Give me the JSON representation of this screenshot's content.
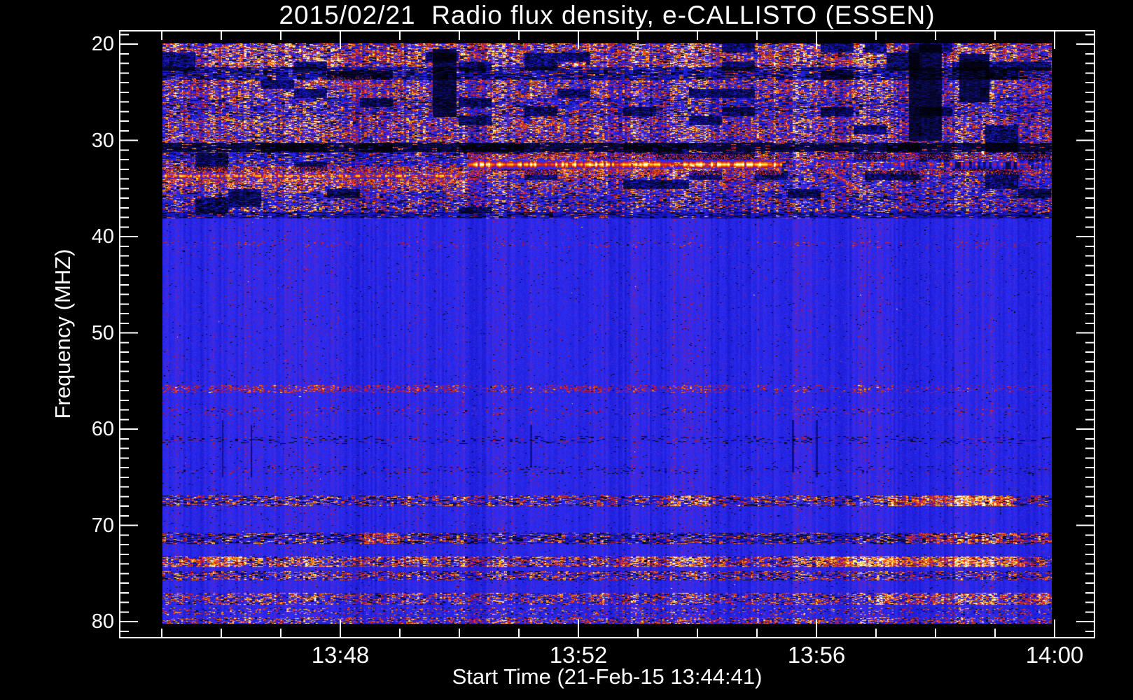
{
  "chart_data": {
    "type": "heatmap",
    "instrument": "spectrogram",
    "title": "2015/02/21  Radio flux density, e-CALLISTO (ESSEN)",
    "xlabel": "Start Time (21-Feb-15 13:44:41)",
    "ylabel": "Frequency (MHZ)",
    "x_axis": {
      "unit": "minutes after 13:44",
      "major_ticks": [
        {
          "label": "13:48",
          "minute": 4
        },
        {
          "label": "13:52",
          "minute": 8
        },
        {
          "label": "13:56",
          "minute": 12
        },
        {
          "label": "14:00",
          "minute": 16
        }
      ],
      "minor_tick_minutes": [
        1,
        2,
        3,
        5,
        6,
        7,
        9,
        10,
        11,
        13,
        14,
        15
      ]
    },
    "y_axis": {
      "unit": "MHz",
      "inverted": true,
      "range_approx": [
        18.6,
        81.7
      ],
      "major_ticks_mhz": [
        20,
        30,
        40,
        50,
        60,
        70,
        80
      ],
      "minor_ticks_mhz": [
        19,
        21,
        22,
        23,
        24,
        25,
        26,
        27,
        28,
        29,
        31,
        32,
        33,
        34,
        35,
        36,
        37,
        38,
        39,
        41,
        42,
        43,
        44,
        45,
        46,
        47,
        48,
        49,
        51,
        52,
        53,
        54,
        55,
        56,
        57,
        58,
        59,
        61,
        62,
        63,
        64,
        65,
        66,
        67,
        68,
        69,
        71,
        72,
        73,
        74,
        75,
        76,
        77,
        78,
        79,
        81
      ]
    },
    "data_extent": {
      "t0_min": 1.01,
      "t1_min": 15.95,
      "f0_mhz": 19.93,
      "f1_mhz": 80.22
    },
    "palette": {
      "stops": [
        [
          0.0,
          "#000000"
        ],
        [
          0.14,
          "#08083c"
        ],
        [
          0.32,
          "#1414c8"
        ],
        [
          0.5,
          "#2e2ef4"
        ],
        [
          0.58,
          "#5a24c8"
        ],
        [
          0.66,
          "#96145a"
        ],
        [
          0.75,
          "#e62814"
        ],
        [
          0.85,
          "#ff8c00"
        ],
        [
          0.93,
          "#fff050"
        ],
        [
          1.0,
          "#ffffff"
        ]
      ]
    },
    "ocean_default": {
      "f0": 0,
      "f1": 0,
      "base": 0.46,
      "amp": 0.1,
      "red": 0.035,
      "spark": 0.002,
      "black": 0.008,
      "dash": 2,
      "redLo": 0.55,
      "redHi": 0.66
    },
    "bands": [
      {
        "f0": 19.9,
        "f1": 22.4,
        "base": 0.45,
        "amp": 0.3,
        "red": 0.5,
        "spark": 0.18,
        "black": 0.18,
        "dash": 5
      },
      {
        "f0": 22.4,
        "f1": 23.7,
        "base": 0.34,
        "amp": 0.22,
        "red": 0.12,
        "spark": 0.02,
        "black": 0.38,
        "dash": 6
      },
      {
        "f0": 23.7,
        "f1": 25.6,
        "base": 0.44,
        "amp": 0.26,
        "red": 0.42,
        "spark": 0.08,
        "black": 0.12,
        "dash": 4
      },
      {
        "f0": 25.6,
        "f1": 27.6,
        "base": 0.42,
        "amp": 0.26,
        "red": 0.28,
        "spark": 0.05,
        "black": 0.22,
        "dash": 5
      },
      {
        "f0": 27.6,
        "f1": 30.2,
        "base": 0.44,
        "amp": 0.26,
        "red": 0.42,
        "spark": 0.1,
        "black": 0.16,
        "dash": 4
      },
      {
        "f0": 30.2,
        "f1": 31.2,
        "base": 0.18,
        "amp": 0.2,
        "red": 0.06,
        "spark": 0.01,
        "black": 0.5,
        "dash": 7
      },
      {
        "f0": 31.2,
        "f1": 32.0,
        "base": 0.4,
        "amp": 0.24,
        "red": 0.2,
        "spark": 0.04,
        "black": 0.26,
        "dash": 5,
        "segs": [
          {
            "t0": 6.1,
            "t1": 16,
            "red": 0.35,
            "spark": 0.06
          }
        ]
      },
      {
        "f0": 32.0,
        "f1": 32.9,
        "base": 0.4,
        "amp": 0.22,
        "red": 0.24,
        "spark": 0.05,
        "black": 0.2,
        "dash": 5
      },
      {
        "f0": 32.9,
        "f1": 33.3,
        "base": 0.4,
        "amp": 0.22,
        "red": 0.3,
        "spark": 0.06,
        "black": 0.2,
        "dash": 4,
        "segs": [
          {
            "t0": 6.1,
            "t1": 11.5,
            "red": 0.5,
            "spark": 0.08
          }
        ]
      },
      {
        "f0": 33.3,
        "f1": 34.0,
        "base": 0.42,
        "amp": 0.22,
        "red": 0.3,
        "spark": 0.06,
        "black": 0.16,
        "dash": 4,
        "segs": [
          {
            "t0": 6.1,
            "t1": 11.5,
            "red": 0.45,
            "spark": 0.06
          }
        ]
      },
      {
        "f0": 34.0,
        "f1": 35.3,
        "base": 0.44,
        "amp": 0.22,
        "red": 0.3,
        "spark": 0.05,
        "black": 0.14,
        "dash": 4,
        "segs": [
          {
            "t0": 1.0,
            "t1": 6.1,
            "red": 0.45,
            "spark": 0.08
          },
          {
            "t0": 6.1,
            "t1": 11.5,
            "red": 0.38,
            "spark": 0.04
          }
        ]
      },
      {
        "f0": 35.3,
        "f1": 36.5,
        "base": 0.42,
        "amp": 0.24,
        "red": 0.26,
        "spark": 0.04,
        "black": 0.2,
        "dash": 5
      },
      {
        "f0": 36.5,
        "f1": 37.4,
        "base": 0.4,
        "amp": 0.24,
        "red": 0.3,
        "spark": 0.05,
        "black": 0.2,
        "dash": 4
      },
      {
        "f0": 37.4,
        "f1": 38.1,
        "base": 0.33,
        "amp": 0.16,
        "red": 0.08,
        "spark": 0.0,
        "black": 0.3,
        "dash": 6
      },
      {
        "f0": 40.5,
        "f1": 41.1,
        "base": 0.46,
        "amp": 0.1,
        "red": 0.1,
        "spark": 0.0,
        "black": 0.01,
        "dash": 3,
        "redLo": 0.58,
        "redHi": 0.72
      },
      {
        "f0": 55.4,
        "f1": 56.2,
        "base": 0.46,
        "amp": 0.1,
        "red": 0.18,
        "spark": 0.01,
        "black": 0.02,
        "dash": 3,
        "redLo": 0.6,
        "redHi": 0.78,
        "segs": [
          {
            "t0": 1.0,
            "t1": 6.0,
            "red": 0.38
          },
          {
            "t0": 7.4,
            "t1": 10.6,
            "red": 0.3
          }
        ]
      },
      {
        "f0": 57.7,
        "f1": 58.5,
        "base": 0.46,
        "amp": 0.1,
        "red": 0.15,
        "spark": 0.0,
        "black": 0.03,
        "dash": 3,
        "redLo": 0.56,
        "redHi": 0.7
      },
      {
        "f0": 60.7,
        "f1": 61.5,
        "base": 0.45,
        "amp": 0.1,
        "red": 0.08,
        "spark": 0.0,
        "black": 0.1,
        "dash": 4,
        "redLo": 0.56,
        "redHi": 0.7
      },
      {
        "f0": 63.8,
        "f1": 64.6,
        "base": 0.45,
        "amp": 0.1,
        "red": 0.08,
        "spark": 0.0,
        "black": 0.05,
        "dash": 3,
        "redLo": 0.56,
        "redHi": 0.7
      },
      {
        "f0": 66.9,
        "f1": 68.0,
        "base": 0.42,
        "amp": 0.18,
        "red": 0.3,
        "spark": 0.03,
        "black": 0.22,
        "dash": 5,
        "segs": [
          {
            "t0": 9.5,
            "t1": 10.3,
            "red": 0.55,
            "spark": 0.12
          },
          {
            "t0": 13.2,
            "t1": 15.3,
            "red": 0.7,
            "spark": 0.3
          },
          {
            "t0": 14.15,
            "t1": 14.85,
            "red": 0.85,
            "spark": 0.5
          }
        ]
      },
      {
        "f0": 70.7,
        "f1": 71.9,
        "base": 0.4,
        "amp": 0.18,
        "red": 0.2,
        "spark": 0.03,
        "black": 0.3,
        "dash": 5,
        "segs": [
          {
            "t0": 4.4,
            "t1": 5.0,
            "red": 0.6,
            "spark": 0.1
          },
          {
            "t0": 13.5,
            "t1": 16.0,
            "red": 0.5,
            "spark": 0.1
          }
        ]
      },
      {
        "f0": 73.2,
        "f1": 74.3,
        "base": 0.42,
        "amp": 0.2,
        "red": 0.5,
        "spark": 0.1,
        "black": 0.2,
        "dash": 4,
        "segs": [
          {
            "t0": 1.6,
            "t1": 2.35,
            "red": 0.8,
            "spark": 0.2
          },
          {
            "t0": 8.7,
            "t1": 10.5,
            "red": 0.7,
            "spark": 0.15
          },
          {
            "t0": 12.0,
            "t1": 15.5,
            "red": 0.85,
            "spark": 0.35
          }
        ]
      },
      {
        "f0": 74.7,
        "f1": 75.7,
        "base": 0.42,
        "amp": 0.18,
        "red": 0.32,
        "spark": 0.03,
        "black": 0.2,
        "dash": 4
      },
      {
        "f0": 77.0,
        "f1": 78.2,
        "base": 0.43,
        "amp": 0.18,
        "red": 0.35,
        "spark": 0.04,
        "black": 0.12,
        "dash": 4,
        "segs": [
          {
            "t0": 13.0,
            "t1": 16.0,
            "red": 0.6,
            "spark": 0.25
          }
        ]
      },
      {
        "f0": 78.5,
        "f1": 79.3,
        "base": 0.45,
        "amp": 0.14,
        "red": 0.15,
        "spark": 0.01,
        "black": 0.05,
        "dash": 3
      },
      {
        "f0": 79.5,
        "f1": 80.3,
        "base": 0.44,
        "amp": 0.16,
        "red": 0.35,
        "spark": 0.03,
        "black": 0.1,
        "dash": 3
      }
    ],
    "bright_lines": [
      {
        "t0": 1.0,
        "t1": 6.08,
        "f0": 33.32,
        "f1": 34.0,
        "peak": 0.95,
        "flick": 0.4,
        "fringe": 0.4
      },
      {
        "t0": 6.12,
        "t1": 11.42,
        "f0": 32.0,
        "f1": 32.95,
        "peak": 1.04,
        "flick": 0.3,
        "fringe": 0.4
      },
      {
        "t0": 11.62,
        "t1": 15.97,
        "f0": 32.0,
        "f1": 32.9,
        "peak": 0.82,
        "flick": 0.55,
        "gap": 0.3,
        "fringe": 0.3
      },
      {
        "t0": 3.85,
        "t1": 4.55,
        "f0": 23.85,
        "f1": 24.35,
        "peak": 0.8,
        "flick": 0.35,
        "fringe": 0.15
      }
    ],
    "streaks": [
      {
        "t0": 5.62,
        "t1": 5.98,
        "fStart": 34.0,
        "fEnd": 36.0,
        "v": 0.72
      },
      {
        "t0": 12.15,
        "t1": 12.7,
        "fStart": 33.0,
        "fEnd": 35.0,
        "v": 0.75
      }
    ],
    "dark_columns": [
      {
        "t0": 5.55,
        "t1": 5.95,
        "f0": 20.5,
        "f1": 27.5
      },
      {
        "t0": 13.55,
        "t1": 14.1,
        "f0": 20.0,
        "f1": 30.0
      },
      {
        "t0": 14.4,
        "t1": 14.9,
        "f0": 21.0,
        "f1": 26.0
      }
    ],
    "comb_artifacts": [
      {
        "t": 2.02,
        "f0": 59.0,
        "f1": 65.0
      },
      {
        "t": 2.5,
        "f0": 59.5,
        "f1": 65.0
      },
      {
        "t": 7.2,
        "f0": 59.5,
        "f1": 64.0
      },
      {
        "t": 11.6,
        "f0": 59.0,
        "f1": 64.5
      },
      {
        "t": 12.0,
        "f0": 59.0,
        "f1": 65.0
      }
    ],
    "white_speck": {
      "t": 3.57,
      "f": 77.4
    }
  }
}
